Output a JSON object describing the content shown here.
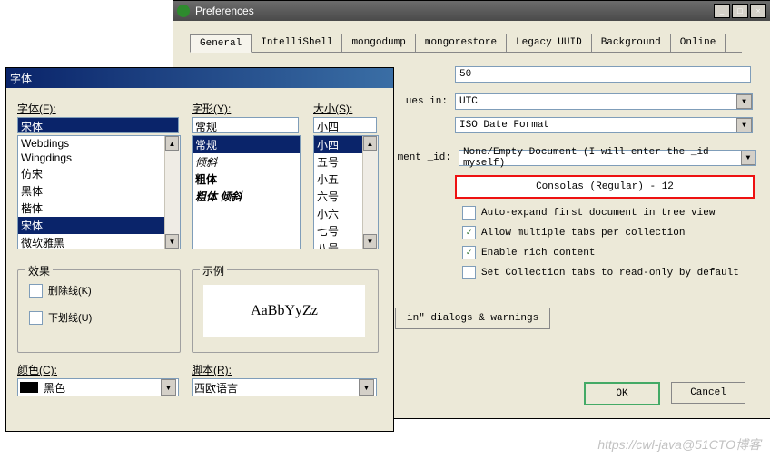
{
  "pref": {
    "title": "Preferences",
    "tabs": [
      "General",
      "IntelliShell",
      "mongodump",
      "mongorestore",
      "Legacy UUID",
      "Background",
      "Online"
    ],
    "active_tab": 0,
    "field_values_in_label": "ues in:",
    "field_ment_id_label": "ment _id:",
    "val_50": "50",
    "val_utc": "UTC",
    "val_iso": "ISO Date Format",
    "val_id": "None/Empty Document (I will enter the _id myself)",
    "font_button": "Consolas (Regular) - 12",
    "check_autoexpand": "Auto-expand first document in tree view",
    "check_multitabs": "Allow multiple tabs per collection",
    "check_rich": "Enable rich content",
    "check_readonly": "Set Collection tabs to read-only by default",
    "reset_btn": "in\" dialogs & warnings",
    "ok": "OK",
    "cancel": "Cancel"
  },
  "font": {
    "title": "字体",
    "label_font": "字体(F):",
    "label_style": "字形(Y):",
    "label_size": "大小(S):",
    "input_font": "宋体",
    "input_style": "常规",
    "input_size": "小四",
    "fonts": [
      "Webdings",
      "Wingdings",
      "仿宋",
      "黑体",
      "楷体",
      "宋体",
      "微软雅黑"
    ],
    "fonts_selected_index": 5,
    "styles": [
      "常规",
      "倾斜",
      "粗体",
      "粗体 倾斜"
    ],
    "styles_selected_index": 0,
    "sizes": [
      "小四",
      "五号",
      "小五",
      "六号",
      "小六",
      "七号",
      "八号"
    ],
    "sizes_selected_index": 0,
    "fs_effects": "效果",
    "chk_strike": "删除线(K)",
    "chk_underline": "下划线(U)",
    "label_color": "颜色(C):",
    "color_name": "黑色",
    "fs_sample": "示例",
    "sample_text": "AaBbYyZz",
    "label_script": "脚本(R):",
    "script_value": "西欧语言"
  },
  "watermark": "https://cwl-java@51CTO博客"
}
